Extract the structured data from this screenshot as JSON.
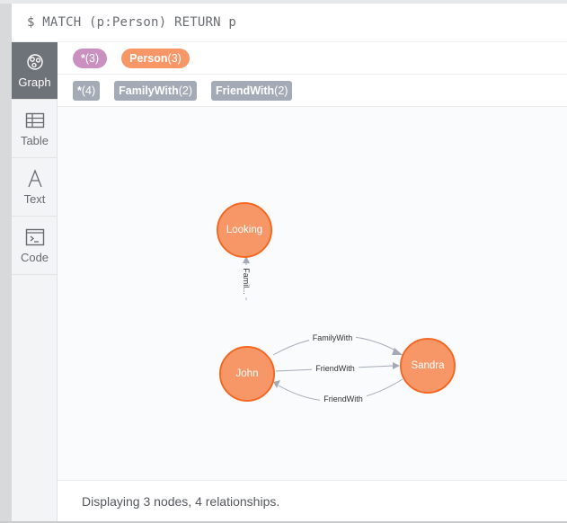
{
  "query": {
    "text": "$ MATCH (p:Person) RETURN p"
  },
  "sidebar": {
    "items": [
      {
        "label": "Graph",
        "icon": "graph-icon",
        "active": true
      },
      {
        "label": "Table",
        "icon": "table-icon",
        "active": false
      },
      {
        "label": "Text",
        "icon": "text-icon",
        "active": false
      },
      {
        "label": "Code",
        "icon": "code-icon",
        "active": false
      }
    ]
  },
  "legend": {
    "labels": [
      {
        "name": "*",
        "count": "(3)",
        "color": "#c990c0"
      },
      {
        "name": "Person",
        "count": "(3)",
        "color": "#f79767"
      }
    ],
    "relationships": [
      {
        "name": "*",
        "count": "(4)"
      },
      {
        "name": "FamilyWith",
        "count": "(2)"
      },
      {
        "name": "FriendWith",
        "count": "(2)"
      }
    ]
  },
  "graph": {
    "nodes": [
      {
        "id": "looking",
        "caption": "Looking"
      },
      {
        "id": "john",
        "caption": "John"
      },
      {
        "id": "sandra",
        "caption": "Sandra"
      }
    ],
    "edges": [
      {
        "from": "john",
        "to": "looking",
        "label": "Famil..."
      },
      {
        "from": "john",
        "to": "sandra",
        "label": "FamilyWith"
      },
      {
        "from": "john",
        "to": "sandra",
        "label": "FriendWith"
      },
      {
        "from": "sandra",
        "to": "john",
        "label": "FriendWith"
      }
    ],
    "colors": {
      "node_fill": "#f79767",
      "node_stroke": "#f36924",
      "edge": "#a5abb6"
    }
  },
  "status": {
    "text": "Displaying 3 nodes, 4 relationships."
  }
}
